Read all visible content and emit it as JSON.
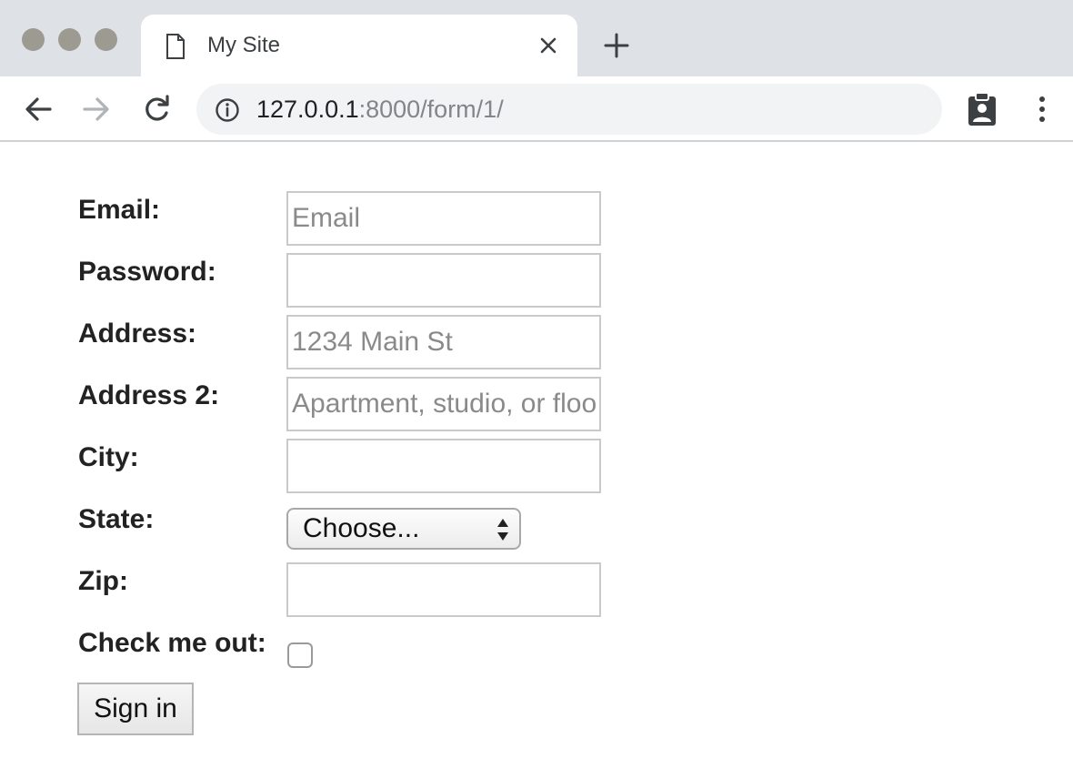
{
  "browser": {
    "tab": {
      "title": "My Site",
      "page_icon": "page-icon",
      "close_icon": "close-icon"
    },
    "new_tab_icon": "plus-icon",
    "nav": {
      "back_icon": "arrow-left-icon",
      "forward_icon": "arrow-right-icon",
      "reload_icon": "reload-icon"
    },
    "address": {
      "host": "127.0.0.1",
      "rest": ":8000/form/1/",
      "info_icon": "info-icon"
    },
    "extension_icon": "clipboard-account-icon",
    "menu_icon": "kebab-menu-icon"
  },
  "form": {
    "email": {
      "label": "Email:",
      "placeholder": "Email",
      "value": ""
    },
    "password": {
      "label": "Password:",
      "placeholder": "",
      "value": ""
    },
    "address": {
      "label": "Address:",
      "placeholder": "1234 Main St",
      "value": ""
    },
    "address2": {
      "label": "Address 2:",
      "placeholder": "Apartment, studio, or floor",
      "value": ""
    },
    "city": {
      "label": "City:",
      "placeholder": "",
      "value": ""
    },
    "state": {
      "label": "State:",
      "selected": "Choose..."
    },
    "zip": {
      "label": "Zip:",
      "placeholder": "",
      "value": ""
    },
    "check": {
      "label": "Check me out:",
      "checked": false
    },
    "submit_label": "Sign in"
  },
  "colors": {
    "tabstrip": "#dee1e6",
    "omnibox": "#f1f3f4",
    "url_host": "#202124",
    "url_rest": "#80868b"
  }
}
